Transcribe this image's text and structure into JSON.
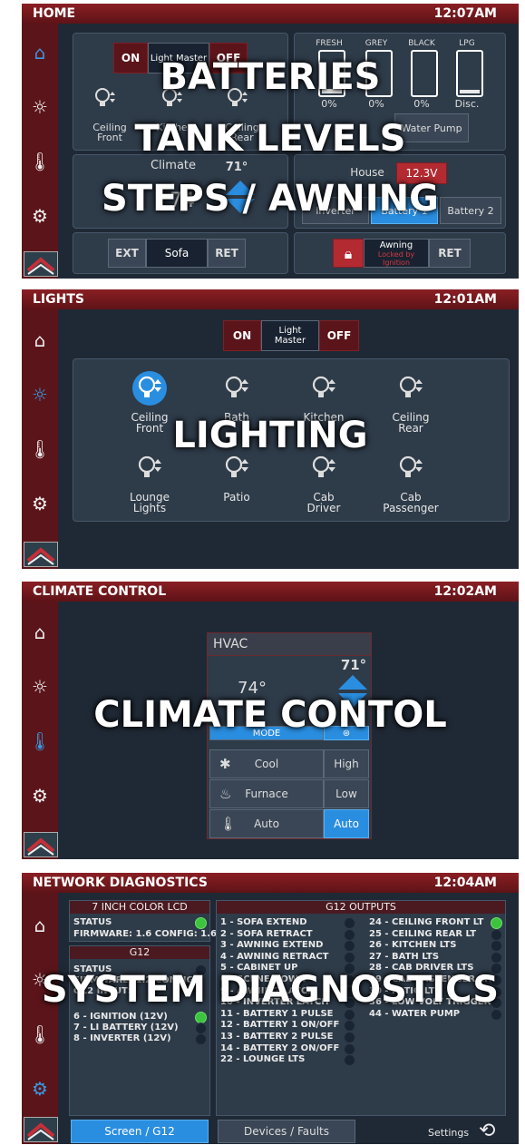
{
  "home": {
    "title": "HOME",
    "clock": "12:07AM",
    "light_on": "ON",
    "light_master": "Light Master",
    "light_off": "OFF",
    "lights": [
      "Ceiling Front",
      "Kitchen",
      "Ceiling Rear"
    ],
    "tanks": [
      {
        "name": "FRESH",
        "value": "0%",
        "level": 0.12
      },
      {
        "name": "GREY",
        "value": "0%",
        "level": 0
      },
      {
        "name": "BLACK",
        "value": "0%",
        "level": 0
      },
      {
        "name": "LPG",
        "value": "Disc.",
        "level": 0.1
      }
    ],
    "water_pump": "Water Pump",
    "climate_label": "Climate",
    "climate_setpoint": "71°",
    "climate_current": "74",
    "house_label": "House",
    "house_voltage": "12.3V",
    "battery_buttons": [
      "Inverter",
      "Battery 1",
      "Battery 2"
    ],
    "steps": [
      "EXT",
      "Sofa",
      "RET"
    ],
    "awning_label": "Awning",
    "awning_locked": "Locked by Ignition",
    "awning_ret": "RET",
    "overlay": [
      "BATTERIES",
      "TANK LEVELS",
      "STEPS / AWNING"
    ]
  },
  "lights": {
    "title": "LIGHTS",
    "clock": "12:01AM",
    "on": "ON",
    "master": "Light Master",
    "off": "OFF",
    "items": [
      {
        "label": "Ceiling Front",
        "active": true
      },
      {
        "label": "Bath",
        "active": false
      },
      {
        "label": "Kitchen",
        "active": false
      },
      {
        "label": "Ceiling Rear",
        "active": false
      },
      {
        "label": "Lounge Lights",
        "active": false
      },
      {
        "label": "Patio",
        "active": false
      },
      {
        "label": "Cab Driver",
        "active": false
      },
      {
        "label": "Cab Passenger",
        "active": false
      }
    ],
    "overlay": "LIGHTING"
  },
  "climate": {
    "title": "CLIMATE CONTROL",
    "clock": "12:02AM",
    "hvac": "HVAC",
    "setpoint": "71°",
    "current": "74°",
    "mode_label": "MODE",
    "modes": [
      "Cool",
      "Furnace",
      "Auto"
    ],
    "fans": [
      "High",
      "Low",
      "Auto"
    ],
    "overlay": "CLIMATE CONTOL"
  },
  "network": {
    "title": "NETWORK DIAGNOSTICS",
    "clock": "12:04AM",
    "lcd_title": "7 INCH COLOR LCD",
    "lcd_status": "STATUS",
    "lcd_firmware": "FIRMWARE: 1.6  CONFIG: 1.6",
    "g12_title": "G12",
    "g12_status": "STATUS",
    "g12_lines": [
      "FIRMWARE: 1.2  CONFIG",
      "G12 INPUTS"
    ],
    "g12_inputs": [
      {
        "label": "6 - IGNITION (12V)",
        "on": true
      },
      {
        "label": "7 - LI BATTERY (12V)",
        "on": false
      },
      {
        "label": "8 - INVERTER (12V)",
        "on": false
      }
    ],
    "outputs_title": "G12 OUTPUTS",
    "outputs_col1": [
      "1 - SOFA EXTEND",
      "2 - SOFA RETRACT",
      "3 - AWNING EXTEND",
      "4 - AWNING RETRACT",
      "5 - CABINET UP",
      "6 - SCENE DOWN",
      "9 - AWNING LATCH",
      "10 - INVERTER LATCH",
      "11 - BATTERY 1 PULSE",
      "12 - BATTERY 1 ON/OFF",
      "13 - BATTERY 2 PULSE",
      "14 - BATTERY 2 ON/OFF",
      "22 - LOUNGE LTS"
    ],
    "outputs_col2": [
      {
        "label": "24 - CEILING FRONT LT",
        "on": true
      },
      {
        "label": "25 - CEILING REAR LT",
        "on": false
      },
      {
        "label": "26 - KITCHEN LTS",
        "on": false
      },
      {
        "label": "27 - BATH LTS",
        "on": false
      },
      {
        "label": "28 - CAB DRIVER LTS",
        "on": false
      },
      {
        "label": "29 - CAB PASSENGER LTS",
        "on": false
      },
      {
        "label": "30 - PATIO LT",
        "on": false
      },
      {
        "label": "36 - LOW VOLT TRIGGER",
        "on": false
      },
      {
        "label": "44 - WATER PUMP",
        "on": false
      }
    ],
    "tab_screen": "Screen / G12",
    "tab_devices": "Devices / Faults",
    "settings": "Settings",
    "overlay": "SYSTEM DIAGNOSTICS"
  },
  "colors": {
    "accent_blue": "#2a8ee0",
    "brand_red": "#8a1f24",
    "status_green": "#3cc43c"
  }
}
